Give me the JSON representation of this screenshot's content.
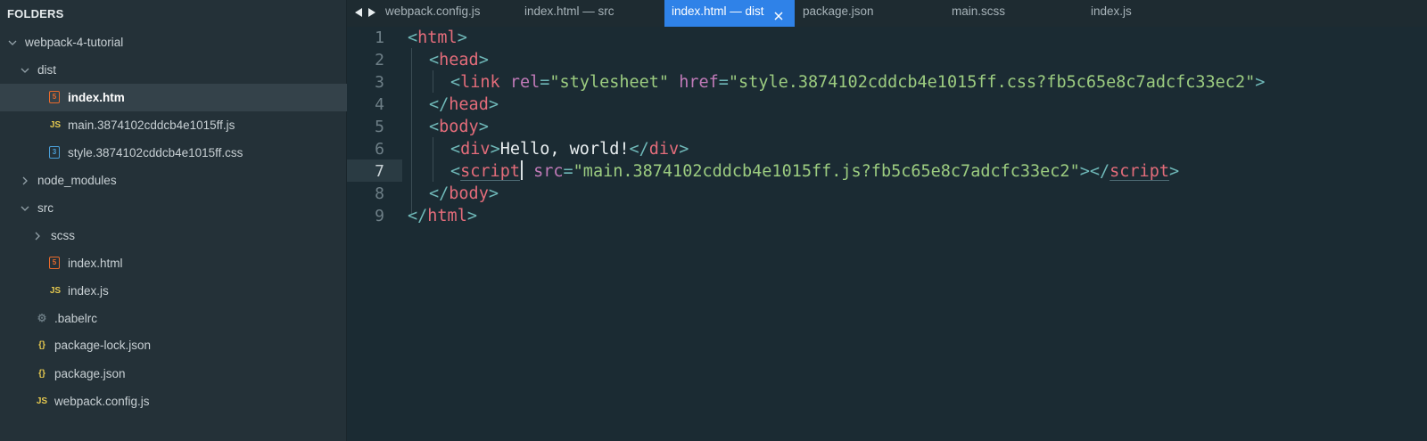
{
  "sidebar": {
    "header": "FOLDERS",
    "items": [
      {
        "label": "webpack-4-tutorial",
        "kind": "folder-open"
      },
      {
        "label": "dist",
        "kind": "folder-open"
      },
      {
        "label": "index.htm",
        "kind": "html",
        "icon_glyph": "5",
        "selected": true
      },
      {
        "label": "main.3874102cddcb4e1015ff.js",
        "kind": "js",
        "icon_glyph": "JS"
      },
      {
        "label": "style.3874102cddcb4e1015ff.css",
        "kind": "css",
        "icon_glyph": "3"
      },
      {
        "label": "node_modules",
        "kind": "folder-closed"
      },
      {
        "label": "src",
        "kind": "folder-open"
      },
      {
        "label": "scss",
        "kind": "folder-closed"
      },
      {
        "label": "index.html",
        "kind": "html",
        "icon_glyph": "5"
      },
      {
        "label": "index.js",
        "kind": "js",
        "icon_glyph": "JS"
      },
      {
        "label": ".babelrc",
        "kind": "config",
        "icon_glyph": "⚙"
      },
      {
        "label": "package-lock.json",
        "kind": "json",
        "icon_glyph": "{}"
      },
      {
        "label": "package.json",
        "kind": "json",
        "icon_glyph": "{}"
      },
      {
        "label": "webpack.config.js",
        "kind": "js",
        "icon_glyph": "JS"
      }
    ]
  },
  "tabs": [
    {
      "label": "webpack.config.js"
    },
    {
      "label": "index.html — src"
    },
    {
      "label": "index.html — dist",
      "active": true
    },
    {
      "label": "package.json"
    },
    {
      "label": "main.scss"
    },
    {
      "label": "index.js"
    }
  ],
  "icons": {
    "nav_back": "triangle-left-icon",
    "nav_forward": "triangle-right-icon",
    "tab_close": "close-icon"
  },
  "editor": {
    "active_line": 7,
    "lines": [
      {
        "n": "1",
        "tokens": [
          [
            "punc",
            "<"
          ],
          [
            "tag",
            "html"
          ],
          [
            "punc",
            ">"
          ]
        ]
      },
      {
        "n": "2",
        "tokens": [
          [
            "punc",
            "<"
          ],
          [
            "tag",
            "head"
          ],
          [
            "punc",
            ">"
          ]
        ]
      },
      {
        "n": "3",
        "tokens": [
          [
            "punc",
            "<"
          ],
          [
            "tag",
            "link"
          ],
          [
            "txt",
            " "
          ],
          [
            "attr",
            "rel"
          ],
          [
            "punc",
            "="
          ],
          [
            "str",
            "\"stylesheet\""
          ],
          [
            "txt",
            " "
          ],
          [
            "attr",
            "href"
          ],
          [
            "punc",
            "="
          ],
          [
            "str",
            "\"style.3874102cddcb4e1015ff.css?fb5c65e8c7adcfc33ec2\""
          ],
          [
            "punc",
            ">"
          ]
        ]
      },
      {
        "n": "4",
        "tokens": [
          [
            "punc",
            "</"
          ],
          [
            "tag",
            "head"
          ],
          [
            "punc",
            ">"
          ]
        ]
      },
      {
        "n": "5",
        "tokens": [
          [
            "punc",
            "<"
          ],
          [
            "tag",
            "body"
          ],
          [
            "punc",
            ">"
          ]
        ]
      },
      {
        "n": "6",
        "tokens": [
          [
            "punc",
            "<"
          ],
          [
            "tag",
            "div"
          ],
          [
            "punc",
            ">"
          ],
          [
            "txt",
            "Hello, world!"
          ],
          [
            "punc",
            "</"
          ],
          [
            "tag",
            "div"
          ],
          [
            "punc",
            ">"
          ]
        ]
      },
      {
        "n": "7",
        "tokens": [
          [
            "punc",
            "<"
          ],
          [
            "tag u",
            "script"
          ],
          [
            "caret",
            ""
          ],
          [
            "txt",
            " "
          ],
          [
            "attr",
            "src"
          ],
          [
            "punc",
            "="
          ],
          [
            "str",
            "\"main.3874102cddcb4e1015ff.js?fb5c65e8c7adcfc33ec2\""
          ],
          [
            "punc",
            "></"
          ],
          [
            "tag u",
            "script"
          ],
          [
            "punc",
            ">"
          ]
        ]
      },
      {
        "n": "8",
        "tokens": [
          [
            "punc",
            "</"
          ],
          [
            "tag",
            "body"
          ],
          [
            "punc",
            ">"
          ]
        ]
      },
      {
        "n": "9",
        "tokens": [
          [
            "punc",
            "</"
          ],
          [
            "tag",
            "html"
          ],
          [
            "punc",
            ">"
          ]
        ]
      }
    ]
  },
  "colors": {
    "sidebar_bg": "#243138",
    "editor_bg": "#1b2b33",
    "active_tab": "#2f82e8",
    "tag": "#e36c7a",
    "attribute": "#c07ab8",
    "string": "#9ccc80",
    "punctuation": "#6fb8b8"
  }
}
